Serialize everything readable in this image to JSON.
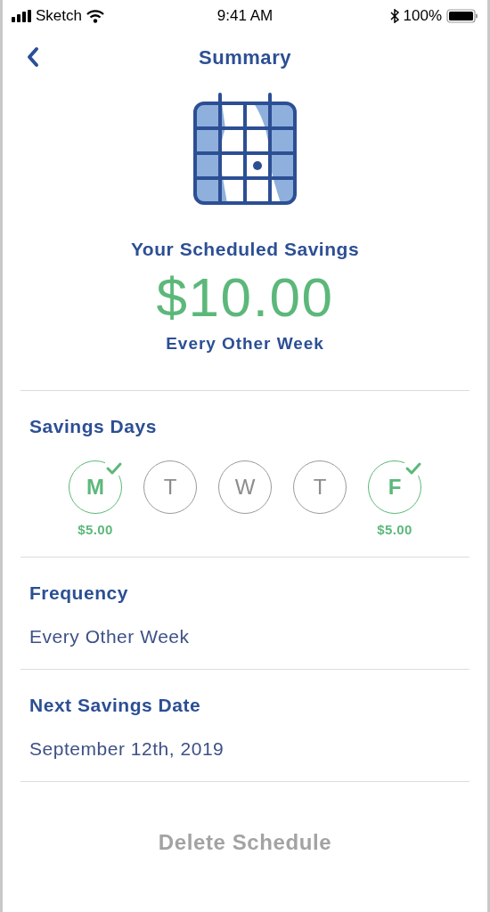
{
  "status_bar": {
    "carrier": "Sketch",
    "time": "9:41 AM",
    "battery": "100%"
  },
  "nav": {
    "title": "Summary"
  },
  "summary": {
    "heading": "Your Scheduled Savings",
    "amount": "$10.00",
    "frequency": "Every Other Week"
  },
  "savings_days": {
    "title": "Savings Days",
    "days": [
      {
        "letter": "M",
        "selected": true,
        "amount": "$5.00"
      },
      {
        "letter": "T",
        "selected": false
      },
      {
        "letter": "W",
        "selected": false
      },
      {
        "letter": "T",
        "selected": false
      },
      {
        "letter": "F",
        "selected": true,
        "amount": "$5.00"
      }
    ]
  },
  "sections": [
    {
      "label": "Frequency",
      "value": "Every Other Week"
    },
    {
      "label": "Next Savings Date",
      "value": "September 12th, 2019"
    }
  ],
  "delete_button": "Delete Schedule"
}
